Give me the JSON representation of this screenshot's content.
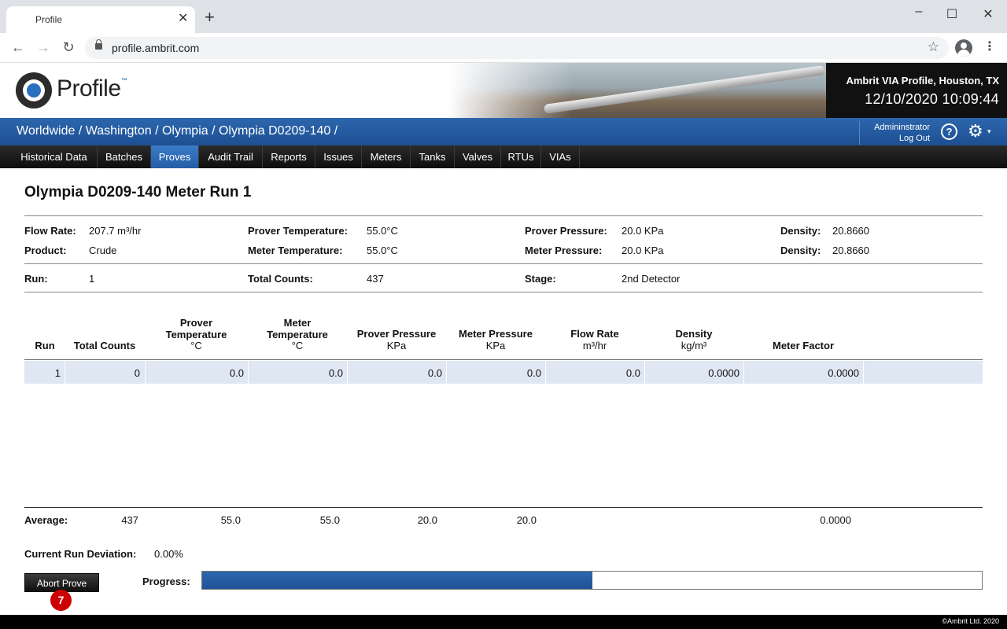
{
  "browser": {
    "tab_title": "Profile",
    "tab_close": "✕",
    "new_tab": "+",
    "url": "profile.ambrit.com",
    "icons": [
      "back-icon",
      "forward-icon",
      "reload-icon",
      "lock-icon",
      "star-icon",
      "profile-icon",
      "menu-icon"
    ]
  },
  "header": {
    "logo_text": "Profile",
    "logo_tm": "™",
    "site_name": "Ambrit VIA Profile, Houston, TX",
    "datetime": "12/10/2020 10:09:44"
  },
  "breadcrumb": "Worldwide / Washington / Olympia / Olympia D0209-140 /",
  "user": {
    "name": "Admininstrator",
    "logout": "Log Out",
    "help": "?",
    "settings": "⚙",
    "settings_caret": "▾"
  },
  "nav": {
    "active": "Proves",
    "items": [
      "Historical Data",
      "Batches",
      "Proves",
      "Audit Trail",
      "Reports",
      "Issues",
      "Meters",
      "Tanks",
      "Valves",
      "RTUs",
      "VIAs"
    ]
  },
  "page": {
    "title": "Olympia D0209-140 Meter Run 1"
  },
  "summary": {
    "flow_rate_label": "Flow Rate:",
    "flow_rate": "207.7 m³/hr",
    "product_label": "Product:",
    "product": "Crude",
    "prover_temp_label": "Prover Temperature:",
    "prover_temp": "55.0°C",
    "meter_temp_label": "Meter Temperature:",
    "meter_temp": "55.0°C",
    "prover_pressure_label": "Prover Pressure:",
    "prover_pressure": "20.0 KPa",
    "meter_pressure_label": "Meter Pressure:",
    "meter_pressure": "20.0 KPa",
    "density1_label": "Density:",
    "density1": "20.8660",
    "density2_label": "Density:",
    "density2": "20.8660",
    "run_label": "Run:",
    "run": "1",
    "total_counts_label": "Total Counts:",
    "total_counts": "437",
    "stage_label": "Stage:",
    "stage": "2nd Detector"
  },
  "table": {
    "headers": {
      "run": "Run",
      "total_counts": "Total Counts",
      "prover_temp_1": "Prover",
      "prover_temp_2": "Temperature",
      "prover_temp_unit": "°C",
      "meter_temp_1": "Meter",
      "meter_temp_2": "Temperature",
      "meter_temp_unit": "°C",
      "prover_pressure": "Prover Pressure",
      "prover_pressure_unit": "KPa",
      "meter_pressure": "Meter Pressure",
      "meter_pressure_unit": "KPa",
      "flow_rate": "Flow Rate",
      "flow_rate_unit": "m³/hr",
      "density": "Density",
      "density_unit": "kg/m³",
      "meter_factor": "Meter Factor"
    },
    "rows": [
      {
        "run": "1",
        "total_counts": "0",
        "prover_temp": "0.0",
        "meter_temp": "0.0",
        "prover_pressure": "0.0",
        "meter_pressure": "0.0",
        "flow_rate": "0.0",
        "density": "0.0000",
        "meter_factor": "0.0000"
      }
    ],
    "average_label": "Average:",
    "average": {
      "total_counts": "437",
      "prover_temp": "55.0",
      "meter_temp": "55.0",
      "prover_pressure": "20.0",
      "meter_pressure": "20.0",
      "meter_factor": "0.0000"
    }
  },
  "deviation": {
    "label": "Current Run Deviation:",
    "value": "0.00%"
  },
  "actions": {
    "abort_label": "Abort Prove",
    "badge": "7"
  },
  "progress": {
    "label": "Progress:",
    "fraction": 0.5
  },
  "footer": "©Ambrit Ltd. 2020"
}
